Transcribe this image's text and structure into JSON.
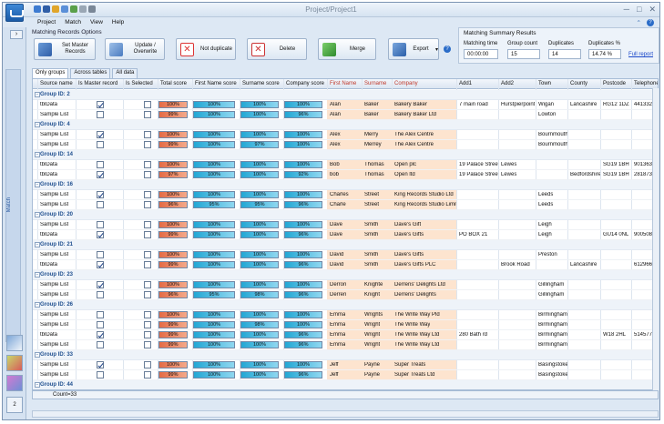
{
  "app": {
    "title": "Project/Project1"
  },
  "menu": [
    "Project",
    "Match",
    "View",
    "Help"
  ],
  "options": {
    "title": "Matching Records Options",
    "buttons": [
      "Set Master Records",
      "Update / Overwrite",
      "Not duplicate",
      "Delete",
      "Merge",
      "Export"
    ]
  },
  "summary": {
    "title": "Matching Summary Results",
    "headers": [
      "Matching time",
      "Group count",
      "Duplicates",
      "Duplicates %"
    ],
    "values": [
      "00:00:00",
      "15",
      "14",
      "14.74 %"
    ],
    "link": "Full report"
  },
  "rail": {
    "label": "Match",
    "bottom": "2"
  },
  "tabs": [
    "Only groups",
    "Across tables",
    "All data"
  ],
  "columns": [
    "Source name",
    "Is Master record",
    "Is Selected",
    "Total score",
    "First Name score",
    "Surname score",
    "Company score",
    "First Name",
    "Surname",
    "Company",
    "Add1",
    "Add2",
    "Town",
    "County",
    "Postcode",
    "Telephone"
  ],
  "rows": [
    {
      "g": "Group ID: 2"
    },
    {
      "s": "tblData",
      "m": true,
      "sel": false,
      "t": "100%",
      "f": "100%",
      "su": "100%",
      "c": "100%",
      "fn": "Alan",
      "sn": "Baker",
      "co": "Bakery Baker",
      "a1": "7 main road",
      "a2": "Hurstpierpoint",
      "tw": "Wigan",
      "cty": "Lancashire",
      "pc": "RG12 1DZ",
      "tel": "4413324"
    },
    {
      "s": "Sample List",
      "m": false,
      "sel": false,
      "t": "99%",
      "f": "100%",
      "su": "100%",
      "c": "96%",
      "fn": "Alan",
      "sn": "Baker",
      "co": "Bakery Baker Ltd",
      "a1": "",
      "a2": "",
      "tw": "Lowton",
      "cty": "",
      "pc": "",
      "tel": ""
    },
    {
      "g": "Group ID: 4"
    },
    {
      "s": "Sample List",
      "m": true,
      "sel": false,
      "t": "100%",
      "f": "100%",
      "su": "100%",
      "c": "100%",
      "fn": "Alex",
      "sn": "Merry",
      "co": "The Alex Centre",
      "a1": "",
      "a2": "",
      "tw": "Bournmouth",
      "cty": "",
      "pc": "",
      "tel": ""
    },
    {
      "s": "Sample List",
      "m": false,
      "sel": false,
      "t": "99%",
      "f": "100%",
      "su": "97%",
      "c": "100%",
      "fn": "Alex",
      "sn": "Merrey",
      "co": "The Alex Centre",
      "a1": "",
      "a2": "",
      "tw": "Bournmouth",
      "cty": "",
      "pc": "",
      "tel": ""
    },
    {
      "g": "Group ID: 14"
    },
    {
      "s": "tblData",
      "m": false,
      "sel": false,
      "t": "100%",
      "f": "100%",
      "su": "100%",
      "c": "100%",
      "fn": "Bob",
      "sn": "Thomas",
      "co": "Open plc",
      "a1": "19 Palace Street",
      "a2": "Lewes",
      "tw": "",
      "cty": "",
      "pc": "SG19 1BH",
      "tel": "901363"
    },
    {
      "s": "tblData",
      "m": true,
      "sel": false,
      "t": "97%",
      "f": "100%",
      "su": "100%",
      "c": "92%",
      "fn": "bob",
      "sn": "Thomas",
      "co": "Open ltd",
      "a1": "19 Palace Street",
      "a2": "Lewes",
      "tw": "",
      "cty": "Bedfordshire",
      "pc": "SG19 1BH",
      "tel": "2818736"
    },
    {
      "g": "Group ID: 16"
    },
    {
      "s": "Sample List",
      "m": true,
      "sel": false,
      "t": "100%",
      "f": "100%",
      "su": "100%",
      "c": "100%",
      "fn": "Charles",
      "sn": "Street",
      "co": "King Records Studio Ltd",
      "a1": "",
      "a2": "",
      "tw": "Leeds",
      "cty": "",
      "pc": "",
      "tel": ""
    },
    {
      "s": "Sample List",
      "m": false,
      "sel": false,
      "t": "96%",
      "f": "95%",
      "su": "95%",
      "c": "96%",
      "fn": "Charle",
      "sn": "Street",
      "co": "King Records Studio Limited",
      "a1": "",
      "a2": "",
      "tw": "Leeds",
      "cty": "",
      "pc": "",
      "tel": ""
    },
    {
      "g": "Group ID: 20"
    },
    {
      "s": "Sample List",
      "m": false,
      "sel": false,
      "t": "100%",
      "f": "100%",
      "su": "100%",
      "c": "100%",
      "fn": "Dave",
      "sn": "Smith",
      "co": "Dave's Gift",
      "a1": "",
      "a2": "",
      "tw": "Leigh",
      "cty": "",
      "pc": "",
      "tel": ""
    },
    {
      "s": "tblData",
      "m": true,
      "sel": false,
      "t": "99%",
      "f": "100%",
      "su": "100%",
      "c": "96%",
      "fn": "Dave",
      "sn": "Smith",
      "co": "Dave's Gifts",
      "a1": "PO BOX 21",
      "a2": "",
      "tw": "Leigh",
      "cty": "",
      "pc": "GU14 0NL",
      "tel": "9005081"
    },
    {
      "g": "Group ID: 21"
    },
    {
      "s": "Sample List",
      "m": false,
      "sel": false,
      "t": "100%",
      "f": "100%",
      "su": "100%",
      "c": "100%",
      "fn": "David",
      "sn": "Smith",
      "co": "Dave's Gifts",
      "a1": "",
      "a2": "",
      "tw": "Preston",
      "cty": "",
      "pc": "",
      "tel": ""
    },
    {
      "s": "tblData",
      "m": true,
      "sel": false,
      "t": "99%",
      "f": "100%",
      "su": "100%",
      "c": "96%",
      "fn": "David",
      "sn": "Smith",
      "co": "Dave's Gifts PLC",
      "a1": "",
      "a2": "Brook Road",
      "tw": "",
      "cty": "Lancashire",
      "pc": "",
      "tel": "6129661"
    },
    {
      "g": "Group ID: 23"
    },
    {
      "s": "Sample List",
      "m": true,
      "sel": false,
      "t": "100%",
      "f": "100%",
      "su": "100%",
      "c": "100%",
      "fn": "Derron",
      "sn": "Knighte",
      "co": "Derrens' Delights Ltd",
      "a1": "",
      "a2": "",
      "tw": "Gillingham",
      "cty": "",
      "pc": "",
      "tel": ""
    },
    {
      "s": "Sample List",
      "m": false,
      "sel": false,
      "t": "96%",
      "f": "95%",
      "su": "98%",
      "c": "96%",
      "fn": "Derren",
      "sn": "Knight",
      "co": "Derrens' Delights",
      "a1": "",
      "a2": "",
      "tw": "Gillingham",
      "cty": "",
      "pc": "",
      "tel": ""
    },
    {
      "g": "Group ID: 26"
    },
    {
      "s": "Sample List",
      "m": false,
      "sel": false,
      "t": "100%",
      "f": "100%",
      "su": "100%",
      "c": "100%",
      "fn": "Emma",
      "sn": "Wrights",
      "co": "The Write Way Pld",
      "a1": "",
      "a2": "",
      "tw": "Birmingham",
      "cty": "",
      "pc": "",
      "tel": ""
    },
    {
      "s": "Sample List",
      "m": false,
      "sel": false,
      "t": "99%",
      "f": "100%",
      "su": "98%",
      "c": "100%",
      "fn": "Emma",
      "sn": "Wright",
      "co": "The Write Way",
      "a1": "",
      "a2": "",
      "tw": "Birmingham",
      "cty": "",
      "pc": "",
      "tel": ""
    },
    {
      "s": "tblData",
      "m": true,
      "sel": false,
      "t": "99%",
      "f": "100%",
      "su": "100%",
      "c": "96%",
      "fn": "Emma",
      "sn": "Wright",
      "co": "The Write Way Ltd",
      "a1": "280 Bath rd",
      "a2": "",
      "tw": "Birmingham",
      "cty": "",
      "pc": "W18 2HL",
      "tel": "5145772"
    },
    {
      "s": "Sample List",
      "m": false,
      "sel": false,
      "t": "99%",
      "f": "100%",
      "su": "100%",
      "c": "96%",
      "fn": "Emma",
      "sn": "Wright",
      "co": "The Write Way Ltd",
      "a1": "",
      "a2": "",
      "tw": "Birmingham",
      "cty": "",
      "pc": "",
      "tel": ""
    },
    {
      "g": "Group ID: 33"
    },
    {
      "s": "Sample List",
      "m": true,
      "sel": false,
      "t": "100%",
      "f": "100%",
      "su": "100%",
      "c": "100%",
      "fn": "Jeff",
      "sn": "Payne",
      "co": "Super Treats",
      "a1": "",
      "a2": "",
      "tw": "Basingstoke",
      "cty": "",
      "pc": "",
      "tel": ""
    },
    {
      "s": "Sample List",
      "m": false,
      "sel": false,
      "t": "99%",
      "f": "100%",
      "su": "100%",
      "c": "96%",
      "fn": "Jeff",
      "sn": "Payne",
      "co": "Super Treats Ltd",
      "a1": "",
      "a2": "",
      "tw": "Basingstoke",
      "cty": "",
      "pc": "",
      "tel": ""
    },
    {
      "g": "Group ID: 44"
    },
    {
      "s": "Sample List",
      "m": true,
      "sel": false,
      "t": "100%",
      "f": "100%",
      "su": "100%",
      "c": "100%",
      "fn": "Lee",
      "sn": "Leighton",
      "co": "Alter Image",
      "a1": "",
      "a2": "",
      "tw": "Leicester",
      "cty": "",
      "pc": "",
      "tel": ""
    }
  ],
  "footer": {
    "count": "Count=33"
  },
  "colors": {
    "accent": "#2a6cc8",
    "score_orange": "#e46b45",
    "score_blue": "#23a7d4"
  }
}
